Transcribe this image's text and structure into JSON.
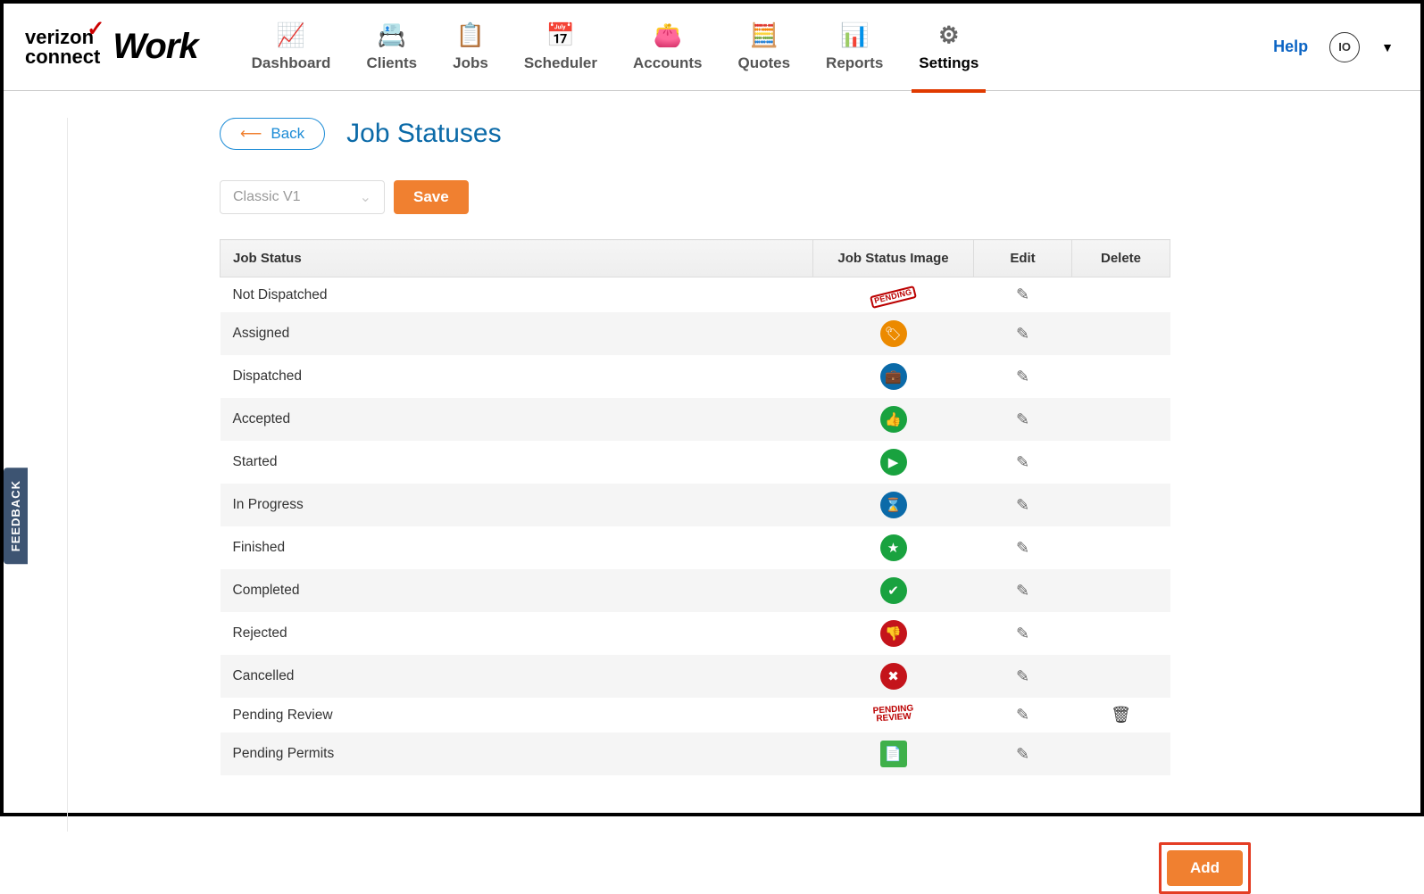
{
  "brand": {
    "line1": "verizon",
    "line2": "connect",
    "product": "Work"
  },
  "nav": [
    {
      "label": "Dashboard",
      "icon": "📈"
    },
    {
      "label": "Clients",
      "icon": "📇"
    },
    {
      "label": "Jobs",
      "icon": "📋"
    },
    {
      "label": "Scheduler",
      "icon": "📅"
    },
    {
      "label": "Accounts",
      "icon": "👛"
    },
    {
      "label": "Quotes",
      "icon": "🧮"
    },
    {
      "label": "Reports",
      "icon": "📊"
    },
    {
      "label": "Settings",
      "icon": "⚙",
      "active": true
    }
  ],
  "header": {
    "help": "Help",
    "avatar": "IO"
  },
  "page": {
    "back": "Back",
    "title": "Job Statuses"
  },
  "toolbar": {
    "select_value": "Classic V1",
    "save": "Save",
    "add": "Add"
  },
  "table": {
    "columns": {
      "status": "Job Status",
      "image": "Job Status Image",
      "edit": "Edit",
      "del": "Delete"
    },
    "rows": [
      {
        "name": "Not Dispatched",
        "img": "stamp-pending",
        "edit": true,
        "del": false
      },
      {
        "name": "Assigned",
        "img": "circle-orange-tag",
        "edit": true,
        "del": false
      },
      {
        "name": "Dispatched",
        "img": "circle-blue-briefcase",
        "edit": true,
        "del": false
      },
      {
        "name": "Accepted",
        "img": "circle-green-thumb",
        "edit": true,
        "del": false
      },
      {
        "name": "Started",
        "img": "circle-green-play",
        "edit": true,
        "del": false
      },
      {
        "name": "In Progress",
        "img": "circle-blue-hourglass",
        "edit": true,
        "del": false
      },
      {
        "name": "Finished",
        "img": "circle-green-star",
        "edit": true,
        "del": false
      },
      {
        "name": "Completed",
        "img": "circle-green-check",
        "edit": true,
        "del": false
      },
      {
        "name": "Rejected",
        "img": "circle-red-thumbdown",
        "edit": true,
        "del": false
      },
      {
        "name": "Cancelled",
        "img": "circle-red-x",
        "edit": true,
        "del": false
      },
      {
        "name": "Pending Review",
        "img": "stamp-pending-review",
        "edit": true,
        "del": true
      },
      {
        "name": "Pending Permits",
        "img": "square-green-doc",
        "edit": true,
        "del": false
      }
    ]
  },
  "feedback": "FEEDBACK"
}
